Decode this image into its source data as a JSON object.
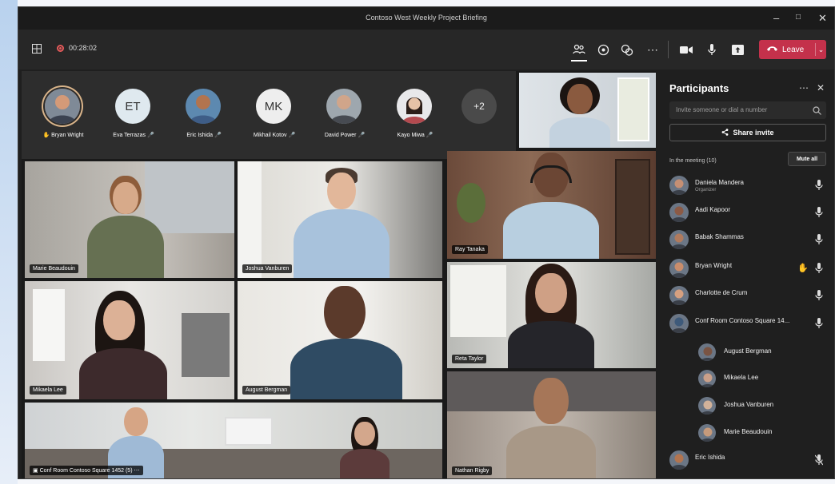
{
  "window": {
    "title": "Contoso West Weekly Project Briefing"
  },
  "toolbar": {
    "timer": "00:28:02",
    "leave_label": "Leave",
    "icons": [
      "grid-icon",
      "record-icon",
      "people-icon",
      "chat-icon",
      "reactions-icon",
      "more-icon",
      "camera-icon",
      "mic-icon",
      "share-icon",
      "phone-icon"
    ]
  },
  "avatar_strip": {
    "people": [
      {
        "name": "Bryan Wright",
        "initials": "",
        "color": "#c98d6c",
        "active": true
      },
      {
        "name": "Eva Terrazas",
        "initials": "ET",
        "color": "#dfe9ef",
        "active": false
      },
      {
        "name": "Eric Ishida",
        "initials": "",
        "color": "#b2744f",
        "active": false
      },
      {
        "name": "Mikhail Kotov",
        "initials": "MK",
        "color": "#eeeeee",
        "active": false
      },
      {
        "name": "David Power",
        "initials": "",
        "color": "#d0a58a",
        "active": false
      },
      {
        "name": "Kayo Miwa",
        "initials": "",
        "color": "#e6c2a7",
        "active": false
      }
    ],
    "more_label": "+2"
  },
  "tiles": {
    "marie": "Marie Beaudouin",
    "joshua": "Joshua Vanburen",
    "ray": "Ray Tanaka",
    "mikaela": "Mikaela Lee",
    "august": "August Bergman",
    "reta": "Reta Taylor",
    "conf": "Conf Room Contoso Square 1452 (5)",
    "nathan": "Nathan Rigby"
  },
  "participants": {
    "title": "Participants",
    "search_placeholder": "Invite someone or dial a number",
    "share_invite": "Share invite",
    "section_title": "In the meeting (10)",
    "mute_all": "Mute all",
    "list": [
      {
        "name": "Daniela Mandera",
        "sub": "Organizer",
        "color": "#c58f74"
      },
      {
        "name": "Aadi Kapoor",
        "sub": "",
        "color": "#8c5a45"
      },
      {
        "name": "Babak Shammas",
        "sub": "",
        "color": "#b07a5d"
      },
      {
        "name": "Bryan Wright",
        "sub": "",
        "color": "#c98d6c"
      },
      {
        "name": "Charlotte de Crum",
        "sub": "",
        "color": "#d6a080"
      },
      {
        "name": "Conf Room Contoso Square 14...",
        "sub": "",
        "color": "#3e5a7a"
      },
      {
        "name": "August Bergman",
        "sub": "",
        "color": "#7a5443"
      },
      {
        "name": "Mikaela Lee",
        "sub": "",
        "color": "#caa08a"
      },
      {
        "name": "Joshua Vanburen",
        "sub": "",
        "color": "#d2b29a"
      },
      {
        "name": "Marie Beaudouin",
        "sub": "",
        "color": "#c69a7b"
      },
      {
        "name": "Eric Ishida",
        "sub": "",
        "color": "#b2744f"
      }
    ]
  }
}
